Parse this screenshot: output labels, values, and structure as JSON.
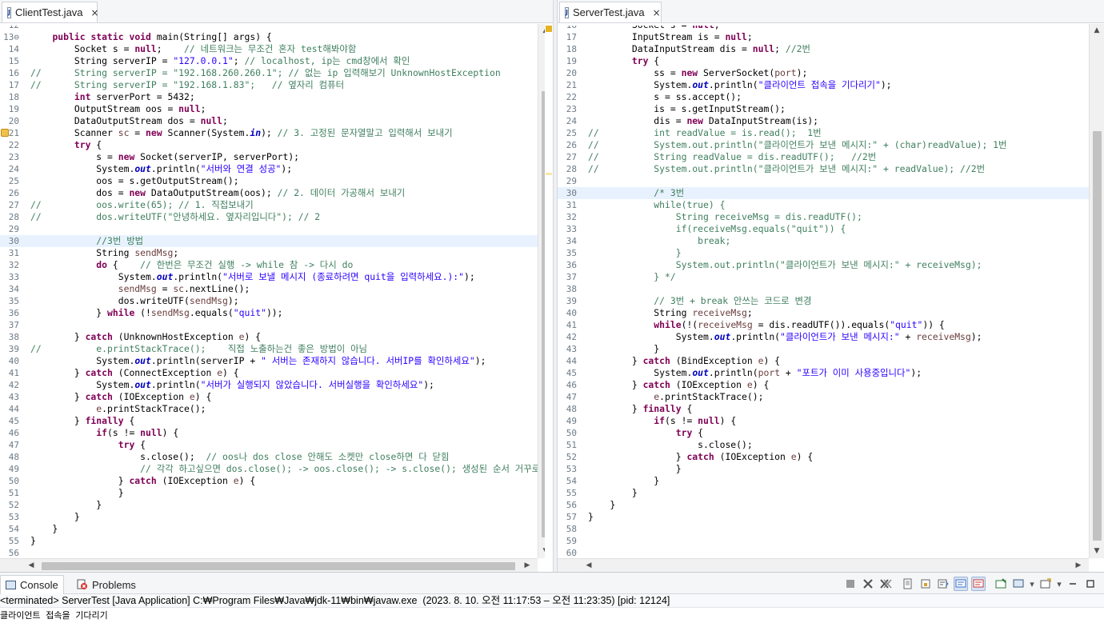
{
  "left_editor": {
    "tab_title": "ClientTest.java",
    "tab_close": "×",
    "first_line_offset": 0,
    "lines": [
      {
        "n": "12",
        "text": ""
      },
      {
        "n": "13⊖",
        "fold": true,
        "html": "    <span class=\"k\">public</span> <span class=\"k\">static</span> <span class=\"k\">void</span> main(String[] args) {"
      },
      {
        "n": "14",
        "html": "        Socket s = <span class=\"k\">null</span>;    <span class=\"c\">// 네트워크는 무조건 혼자 test해봐야함</span>"
      },
      {
        "n": "15",
        "html": "        String serverIP = <span class=\"s\">\"127.0.0.1\"</span>; <span class=\"c\">// localhost, ip는 cmd창에서 확인</span>"
      },
      {
        "n": "16",
        "html": "<span class=\"c\">//      String serverIP = \"192.168.260.260.1\"; // 없는 ip 입력해보기 UnknownHostException</span>"
      },
      {
        "n": "17",
        "html": "<span class=\"c\">//      String serverIP = \"192.168.1.83\";   // 옆자리 컴퓨터</span>"
      },
      {
        "n": "18",
        "html": "        <span class=\"k\">int</span> serverPort = 5432;"
      },
      {
        "n": "19",
        "html": "        OutputStream oos = <span class=\"k\">null</span>;"
      },
      {
        "n": "20",
        "html": "        DataOutputStream dos = <span class=\"k\">null</span>;"
      },
      {
        "n": "21",
        "warn": true,
        "html": "        Scanner <span class=\"v\">sc</span> = <span class=\"k\">new</span> Scanner(System.<span class=\"f\">in</span>); <span class=\"c\">// 3. 고정된 문자열말고 입력해서 보내기</span>"
      },
      {
        "n": "22",
        "html": "        <span class=\"k\">try</span> {"
      },
      {
        "n": "23",
        "html": "            s = <span class=\"k\">new</span> Socket(serverIP, serverPort);"
      },
      {
        "n": "24",
        "html": "            System.<span class=\"f\">out</span>.println(<span class=\"s\">\"서버와 연결 성공\"</span>);"
      },
      {
        "n": "25",
        "html": "            oos = s.getOutputStream();"
      },
      {
        "n": "26",
        "html": "            dos = <span class=\"k\">new</span> DataOutputStream(oos); <span class=\"c\">// 2. 데이터 가공해서 보내기</span>"
      },
      {
        "n": "27",
        "html": "<span class=\"c\">//          oos.write(65); // 1. 직접보내기</span>"
      },
      {
        "n": "28",
        "html": "<span class=\"c\">//          dos.writeUTF(\"안녕하세요. 옆자리입니다\"); // 2</span>"
      },
      {
        "n": "29",
        "html": ""
      },
      {
        "n": "30",
        "hl": true,
        "html": "            <span class=\"c\">//3번 방법</span>"
      },
      {
        "n": "31",
        "html": "            String <span class=\"v\">sendMsg</span>;"
      },
      {
        "n": "32",
        "html": "            <span class=\"k\">do</span> {    <span class=\"c\">// 한번은 무조건 실행 -> while 참 -> 다시 do</span>"
      },
      {
        "n": "33",
        "html": "                System.<span class=\"f\">out</span>.println(<span class=\"s\">\"서버로 보낼 메시지 (종료하려면 quit을 입력하세요.):\"</span>);"
      },
      {
        "n": "34",
        "html": "                <span class=\"v\">sendMsg</span> = <span class=\"v\">sc</span>.nextLine();"
      },
      {
        "n": "35",
        "html": "                dos.writeUTF(<span class=\"v\">sendMsg</span>);"
      },
      {
        "n": "36",
        "html": "            } <span class=\"k\">while</span> (!<span class=\"v\">sendMsg</span>.equals(<span class=\"s\">\"quit\"</span>));"
      },
      {
        "n": "37",
        "html": ""
      },
      {
        "n": "38",
        "html": "        } <span class=\"k\">catch</span> (UnknownHostException <span class=\"v\">e</span>) {"
      },
      {
        "n": "39",
        "html": "<span class=\"c\">//          e.printStackTrace();    직접 노출하는건 좋은 방법이 아님</span>"
      },
      {
        "n": "40",
        "html": "            System.<span class=\"f\">out</span>.println(serverIP + <span class=\"s\">\" 서버는 존재하지 않습니다. 서버IP를 확인하세요\"</span>);"
      },
      {
        "n": "41",
        "html": "        } <span class=\"k\">catch</span> (ConnectException <span class=\"v\">e</span>) {"
      },
      {
        "n": "42",
        "html": "            System.<span class=\"f\">out</span>.println(<span class=\"s\">\"서버가 실행되지 않았습니다. 서버실행을 확인하세요\"</span>);"
      },
      {
        "n": "43",
        "html": "        } <span class=\"k\">catch</span> (IOException <span class=\"v\">e</span>) {"
      },
      {
        "n": "44",
        "html": "            <span class=\"v\">e</span>.printStackTrace();"
      },
      {
        "n": "45",
        "html": "        } <span class=\"k\">finally</span> {"
      },
      {
        "n": "46",
        "html": "            <span class=\"k\">if</span>(s != <span class=\"k\">null</span>) {"
      },
      {
        "n": "47",
        "html": "                <span class=\"k\">try</span> {"
      },
      {
        "n": "48",
        "html": "                    s.close();  <span class=\"c\">// oos나 dos close 안해도 소켓만 close하면 다 닫힘</span>"
      },
      {
        "n": "49",
        "html": "                    <span class=\"c\">// 각각 하고싶으면 dos.close(); -> oos.close(); -> s.close(); 생성된 순서 거꾸로</span>"
      },
      {
        "n": "50",
        "html": "                } <span class=\"k\">catch</span> (IOException <span class=\"v\">e</span>) {"
      },
      {
        "n": "51",
        "html": "                }"
      },
      {
        "n": "52",
        "html": "            }"
      },
      {
        "n": "53",
        "html": "        }"
      },
      {
        "n": "54",
        "html": "    }"
      },
      {
        "n": "55",
        "html": "}"
      },
      {
        "n": "56",
        "html": ""
      }
    ]
  },
  "right_editor": {
    "tab_title": "ServerTest.java",
    "tab_close": "×",
    "lines": [
      {
        "n": "16",
        "html": "        Socket s = <span class=\"k\">null</span>;"
      },
      {
        "n": "17",
        "html": "        InputStream is = <span class=\"k\">null</span>;"
      },
      {
        "n": "18",
        "html": "        DataInputStream dis = <span class=\"k\">null</span>; <span class=\"c\">//2번</span>"
      },
      {
        "n": "19",
        "html": "        <span class=\"k\">try</span> {"
      },
      {
        "n": "20",
        "html": "            ss = <span class=\"k\">new</span> ServerSocket(<span class=\"v\">port</span>);"
      },
      {
        "n": "21",
        "html": "            System.<span class=\"f\">out</span>.println(<span class=\"s\">\"클라이언트 접속을 기다리기\"</span>);"
      },
      {
        "n": "22",
        "html": "            s = ss.accept();"
      },
      {
        "n": "23",
        "html": "            is = s.getInputStream();"
      },
      {
        "n": "24",
        "html": "            dis = <span class=\"k\">new</span> DataInputStream(is);"
      },
      {
        "n": "25",
        "html": "<span class=\"c\">//          int readValue = is.read();  1번</span>"
      },
      {
        "n": "26",
        "html": "<span class=\"c\">//          System.out.println(\"클라이언트가 보낸 메시지:\" + (char)readValue); 1번</span>"
      },
      {
        "n": "27",
        "html": "<span class=\"c\">//          String readValue = dis.readUTF();   //2번</span>"
      },
      {
        "n": "28",
        "html": "<span class=\"c\">//          System.out.println(\"클라이언트가 보낸 메시지:\" + readValue); //2번</span>"
      },
      {
        "n": "29",
        "html": ""
      },
      {
        "n": "30",
        "hl": true,
        "html": "            <span class=\"c\">/* 3번</span>"
      },
      {
        "n": "31",
        "html": "<span class=\"c\">            while(true) {</span>"
      },
      {
        "n": "32",
        "html": "<span class=\"c\">                String receiveMsg = dis.readUTF();</span>"
      },
      {
        "n": "33",
        "html": "<span class=\"c\">                if(receiveMsg.equals(\"quit\")) {</span>"
      },
      {
        "n": "34",
        "html": "<span class=\"c\">                    break;</span>"
      },
      {
        "n": "35",
        "html": "<span class=\"c\">                }</span>"
      },
      {
        "n": "36",
        "html": "<span class=\"c\">                System.out.println(\"클라이언트가 보낸 메시지:\" + receiveMsg);</span>"
      },
      {
        "n": "37",
        "html": "<span class=\"c\">            } */</span>"
      },
      {
        "n": "38",
        "html": ""
      },
      {
        "n": "39",
        "html": "            <span class=\"c\">// 3번 + break 안쓰는 코드로 변경</span>"
      },
      {
        "n": "40",
        "html": "            String <span class=\"v\">receiveMsg</span>;"
      },
      {
        "n": "41",
        "html": "            <span class=\"k\">while</span>(!(<span class=\"v\">receiveMsg</span> = dis.readUTF()).equals(<span class=\"s\">\"quit\"</span>)) {"
      },
      {
        "n": "42",
        "html": "                System.<span class=\"f\">out</span>.println(<span class=\"s\">\"클라이언트가 보낸 메시지:\"</span> + <span class=\"v\">receiveMsg</span>);"
      },
      {
        "n": "43",
        "html": "            }"
      },
      {
        "n": "44",
        "html": "        } <span class=\"k\">catch</span> (BindException <span class=\"v\">e</span>) {"
      },
      {
        "n": "45",
        "html": "            System.<span class=\"f\">out</span>.println(<span class=\"v\">port</span> + <span class=\"s\">\"포트가 이미 사용중입니다\"</span>);"
      },
      {
        "n": "46",
        "html": "        } <span class=\"k\">catch</span> (IOException <span class=\"v\">e</span>) {"
      },
      {
        "n": "47",
        "html": "            <span class=\"v\">e</span>.printStackTrace();"
      },
      {
        "n": "48",
        "html": "        } <span class=\"k\">finally</span> {"
      },
      {
        "n": "49",
        "html": "            <span class=\"k\">if</span>(s != <span class=\"k\">null</span>) {"
      },
      {
        "n": "50",
        "html": "                <span class=\"k\">try</span> {"
      },
      {
        "n": "51",
        "html": "                    s.close();"
      },
      {
        "n": "52",
        "html": "                } <span class=\"k\">catch</span> (IOException <span class=\"v\">e</span>) {"
      },
      {
        "n": "53",
        "html": "                }"
      },
      {
        "n": "54",
        "html": "            }"
      },
      {
        "n": "55",
        "html": "        }"
      },
      {
        "n": "56",
        "html": "    }"
      },
      {
        "n": "57",
        "html": "}"
      },
      {
        "n": "58",
        "html": ""
      },
      {
        "n": "59",
        "html": ""
      },
      {
        "n": "60",
        "html": ""
      }
    ]
  },
  "console": {
    "tabs": [
      {
        "label": "Console",
        "icon": "console-icon",
        "active": true
      },
      {
        "label": "Problems",
        "icon": "problems-icon",
        "active": false
      }
    ],
    "toolbar_icons": [
      "terminate-icon",
      "remove-launch-icon",
      "remove-all-launches-icon",
      "clear-console-icon",
      "scroll-lock-icon",
      "word-wrap-icon",
      "show-on-stdout-icon",
      "show-on-stderr-icon",
      "pin-console-icon",
      "display-console-icon",
      "open-console-icon",
      "minimize-icon",
      "maximize-icon"
    ],
    "status": "<terminated> ServerTest [Java Application] C:₩Program Files₩Java₩jdk-11₩bin₩javaw.exe  (2023. 8. 10. 오전 11:17:53 – 오전 11:23:35) [pid: 12124]",
    "output": "클라이언트 접속을 기다리기"
  },
  "colors": {
    "keyword": "#7f0055",
    "string": "#2a00ff",
    "comment": "#3f7f5f",
    "static_field": "#0000c0",
    "current_line": "#e8f2fe",
    "tab_accent": "#4a7fd1"
  }
}
